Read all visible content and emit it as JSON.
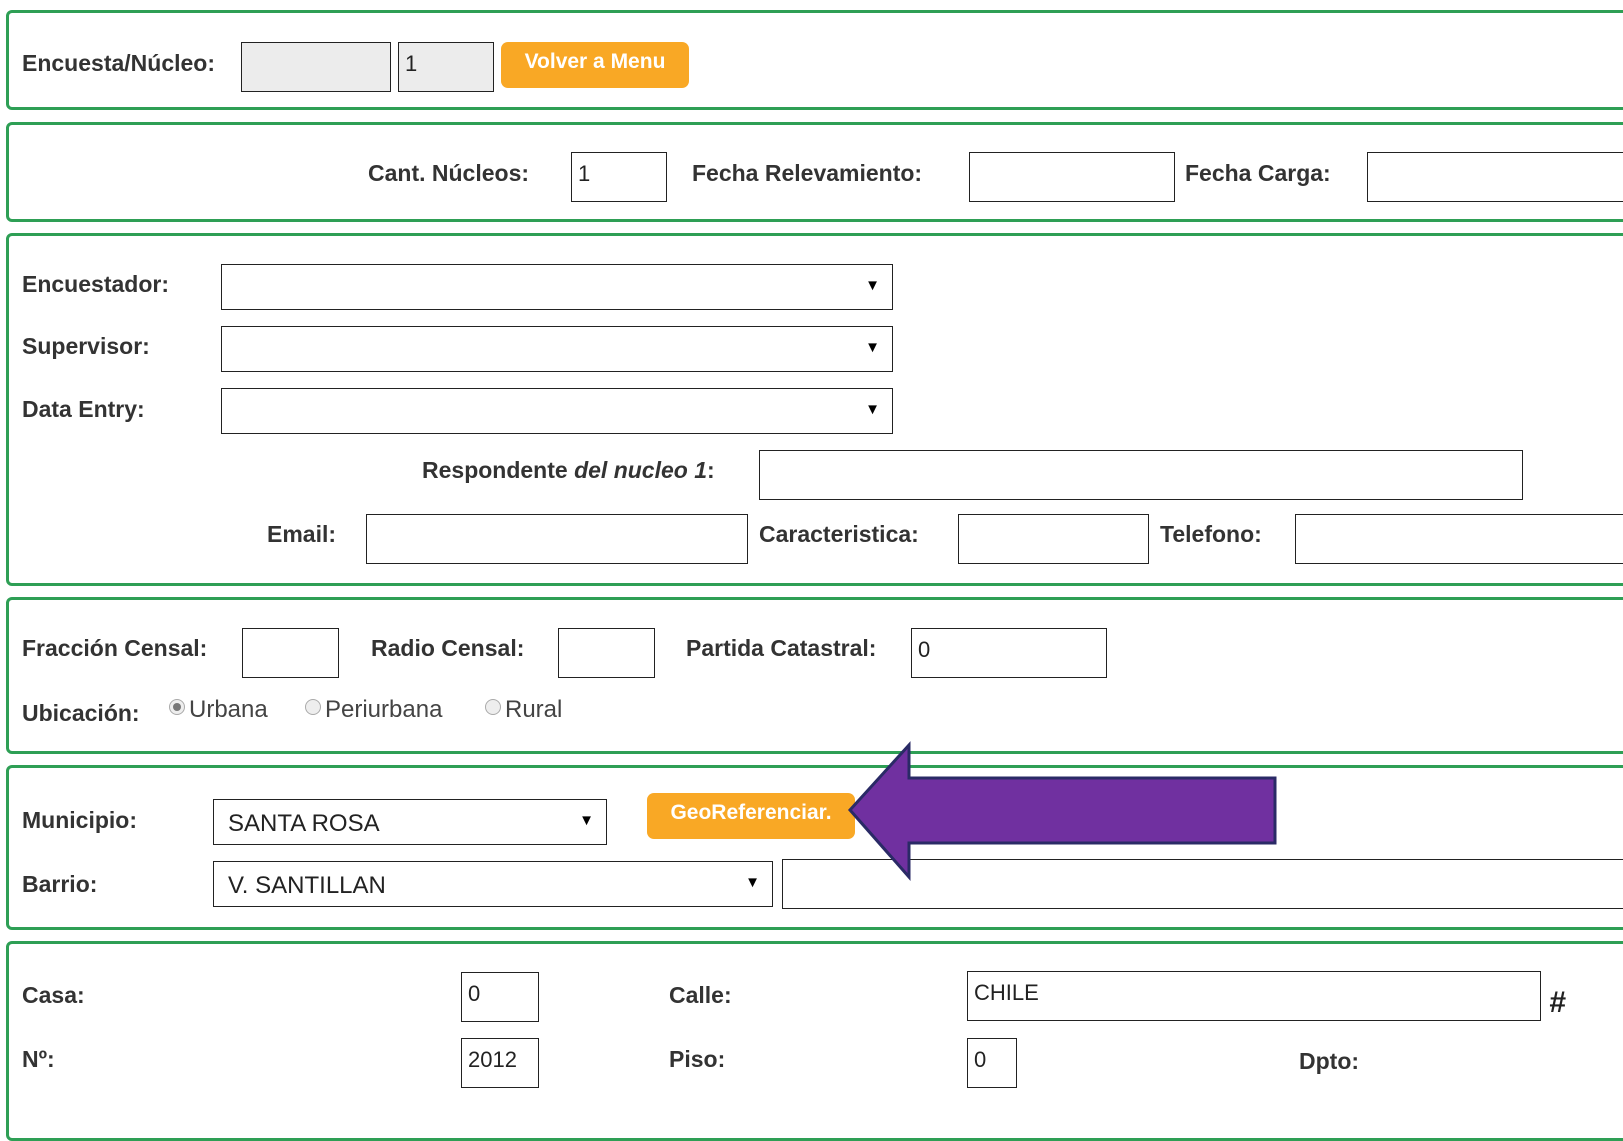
{
  "header": {
    "encuesta_label": "Encuesta/Núcleo:",
    "encuesta_value": "",
    "nucleo_value": "1",
    "volver_label": "Volver a Menu"
  },
  "fechas": {
    "cant_label": "Cant. Núcleos:",
    "cant_value": "1",
    "relev_label": "Fecha Relevamiento:",
    "relev_value": "",
    "carga_label": "Fecha Carga:",
    "carga_value": ""
  },
  "personal": {
    "encuestador_label": "Encuestador:",
    "encuestador_value": "",
    "supervisor_label": "Supervisor:",
    "supervisor_value": "",
    "dataentry_label": "Data Entry:",
    "dataentry_value": "",
    "respondente_label_a": "Respondente ",
    "respondente_label_b": "del nucleo 1",
    "respondente_label_c": ":",
    "respondente_value": "",
    "email_label": "Email:",
    "email_value": "",
    "caracteristica_label": "Caracteristica:",
    "caracteristica_value": "",
    "telefono_label": "Telefono:",
    "telefono_value": ""
  },
  "censo": {
    "fraccion_label": "Fracción Censal:",
    "fraccion_value": "",
    "radio_label": "Radio Censal:",
    "radio_value": "",
    "partida_label": "Partida Catastral:",
    "partida_value": "0",
    "ubicacion_label": "Ubicación:",
    "options": [
      "Urbana",
      "Periurbana",
      "Rural"
    ],
    "selected": "Urbana"
  },
  "ubic": {
    "municipio_label": "Municipio:",
    "municipio_value": "SANTA ROSA",
    "geo_label": "GeoReferenciar.",
    "barrio_label": "Barrio:",
    "barrio_value": "V. SANTILLAN",
    "barrio_extra": ""
  },
  "domicilio": {
    "casa_label": "Casa:",
    "casa_value": "0",
    "calle_label": "Calle:",
    "calle_value": "CHILE",
    "hash_text": "#",
    "numero_label": "Nº:",
    "numero_value": "2012",
    "piso_label": "Piso:",
    "piso_value": "0",
    "dpto_label": "Dpto:"
  },
  "colors": {
    "panel_border": "#2e9f55",
    "button": "#f9a825",
    "annotation_arrow": "#7030a0"
  }
}
